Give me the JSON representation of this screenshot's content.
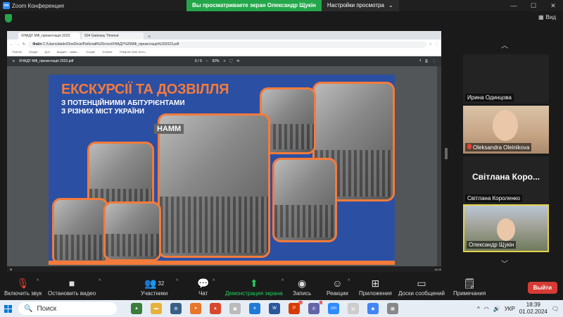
{
  "window": {
    "title": "Zoom Конференция"
  },
  "share_banner": {
    "status": "Вы просматриваете экран Олександр Щукін",
    "options_label": "Настройки просмотра"
  },
  "view_button": {
    "label": "Вид"
  },
  "browser": {
    "tabs": [
      "ХНАДУ МФ_презентація 2023",
      "504 Gateway Timeout"
    ],
    "url": "C:/Users/aledo/OneDrive/Рабочий%20стол/ХНАДУ%20МФ_презентація%202023.pdf",
    "url_prefix": "Файл",
    "bookmarks": [
      "Robots",
      "Google",
      "Доп",
      "Бюджет - заявк...",
      "Google",
      "Youtube",
      "Telegram Web Direc..."
    ]
  },
  "pdf_viewer": {
    "title": "ХНАДУ МФ_презентація 2023.pdf",
    "page_current": "6",
    "page_sep": "/",
    "page_total": "9",
    "zoom": "92%"
  },
  "slide": {
    "title": "ЕКСКУРСІЇ ТА ДОЗВІЛЛЯ",
    "subtitle_line1": "З ПОТЕНЦІЙНИМИ АБІТУРІЄНТАМИ",
    "subtitle_line2": "З РІЗНИХ МІСТ УКРАЇНИ",
    "photo_sign": "HAMM"
  },
  "participants": [
    {
      "name": "Ирина Одинцова",
      "type": "name-only"
    },
    {
      "name": "Oleksandra Oleinikova",
      "type": "video",
      "muted": true
    },
    {
      "name": "Світлана Короленко",
      "display": "Світлана Коро...",
      "type": "name-only"
    },
    {
      "name": "Олександр Щукін",
      "type": "video",
      "active_speaker": true
    }
  ],
  "controls": {
    "unmute": "Включить звук",
    "start_video": "Остановить видео",
    "participants": "Участники",
    "participants_count": "32",
    "chat": "Чат",
    "share": "Демонстрация экрана",
    "record": "Запись",
    "reactions": "Реакции",
    "apps": "Приложения",
    "whiteboards": "Доски сообщений",
    "notes": "Примечания",
    "leave": "Выйти"
  },
  "taskbar": {
    "search_placeholder": "Поиск",
    "lang": "УКР",
    "time": "18:39",
    "date": "01.02.2024",
    "badge_a": "20",
    "badge_b": "2"
  },
  "colors": {
    "accent_green": "#23a74a",
    "zoom_blue": "#2d8cff",
    "slide_blue": "#2b4fa3",
    "slide_orange": "#f47b3b",
    "leave_red": "#d73b35"
  }
}
